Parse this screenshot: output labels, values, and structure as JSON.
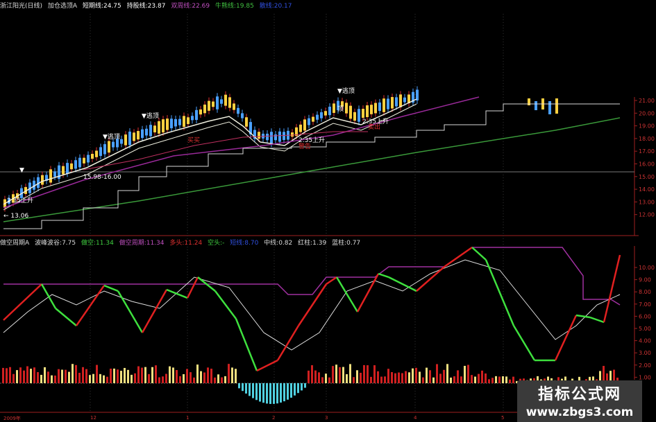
{
  "colors": {
    "up": "#e03030",
    "down": "#4aa0ff",
    "yellow": "#ffd040",
    "ma_white": "#f0f0e0",
    "ma_purple": "#9a2a9a",
    "ma_magenta": "#c03060",
    "ma_green": "#3a9a3a",
    "support": "#d8d8d8",
    "k_red": "#e02020",
    "k_green": "#3ee03e",
    "ceiling": "#a030a0",
    "hist_red": "#d02020",
    "hist_yellow": "#f0e080",
    "hist_cyan": "#50d0e0"
  },
  "top_bar": {
    "stock": "浙江阳光(日线)",
    "select_label": "加仓选顶A",
    "short_line": "短期线:24.75",
    "hold_line": "持股线:23.87",
    "mid_line": "双周线:22.69",
    "cow_line": "牛熊线:19.85",
    "extra": "散线:20.17"
  },
  "indicator_bar": {
    "name": "做空周期A",
    "wave": "波峰波谷:7.75",
    "short": "做空:11.34",
    "cycle": "做空周期:11.34",
    "long": "多头:11.24",
    "empty": "空头:-",
    "other": "短线:8.70",
    "center": "中线:0.82",
    "red_col": "红柱:1.39",
    "blue_col": "蓝柱:0.77"
  },
  "price_axis": [
    "21.00",
    "20.00",
    "19.00",
    "18.00",
    "17.00",
    "16.00",
    "15.00",
    "14.00",
    "13.00",
    "12.00"
  ],
  "ind_axis": [
    "10.00",
    "9.00",
    "8.00",
    "7.00",
    "6.00",
    "5.00",
    "4.00",
    "3.00",
    "2.00",
    "1.00"
  ],
  "annotations": {
    "top1": "▼逃顶",
    "top2": "▼逃顶",
    "top3": "▼逃顶",
    "top4": "▼",
    "top5": "▼逃顶",
    "top6": "顶",
    "rise1": "2.35上升",
    "rise2": "2.35上升",
    "rise3": "2.35上升",
    "range": "15.98-16.00",
    "low": "← 13.06",
    "buy1": "买买",
    "buy2": "卖出",
    "warn": "警告",
    "buy3": "买卖"
  },
  "dates": [
    "2009年",
    "12",
    "1",
    "2",
    "3",
    "4",
    "5"
  ],
  "watermark": {
    "title": "指标公式网",
    "url": "www.zbgs3.com"
  }
}
